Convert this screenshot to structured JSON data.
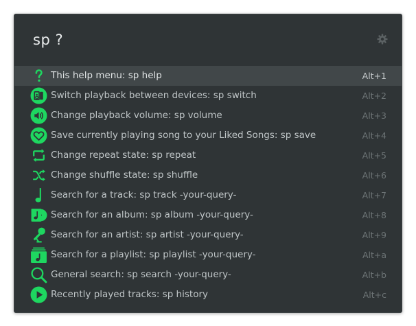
{
  "query": {
    "value": "sp ?"
  },
  "preferences": {
    "icon": "gear-icon"
  },
  "accent_color": "#1ed760",
  "results": [
    {
      "icon": "question-mark-icon",
      "label": "This help menu: sp help",
      "shortcut": "Alt+1",
      "selected": true
    },
    {
      "icon": "devices-icon",
      "label": "Switch playback between devices: sp switch",
      "shortcut": "Alt+2"
    },
    {
      "icon": "volume-icon",
      "label": "Change playback volume: sp volume",
      "shortcut": "Alt+3"
    },
    {
      "icon": "heart-icon",
      "label": "Save currently playing song to your Liked Songs: sp save",
      "shortcut": "Alt+4"
    },
    {
      "icon": "repeat-icon",
      "label": "Change repeat state: sp repeat",
      "shortcut": "Alt+5"
    },
    {
      "icon": "shuffle-icon",
      "label": "Change shuffle state: sp shuffle",
      "shortcut": "Alt+6"
    },
    {
      "icon": "music-note-icon",
      "label": "Search for a track: sp track -your-query-",
      "shortcut": "Alt+7"
    },
    {
      "icon": "album-icon",
      "label": "Search for an album: sp album -your-query-",
      "shortcut": "Alt+8"
    },
    {
      "icon": "microphone-icon",
      "label": "Search for an artist: sp artist -your-query-",
      "shortcut": "Alt+9"
    },
    {
      "icon": "playlist-icon",
      "label": "Search for a playlist: sp playlist -your-query-",
      "shortcut": "Alt+a"
    },
    {
      "icon": "search-icon",
      "label": "General search: sp search -your-query-",
      "shortcut": "Alt+b"
    },
    {
      "icon": "play-circle-icon",
      "label": "Recently played tracks: sp history",
      "shortcut": "Alt+c"
    }
  ]
}
